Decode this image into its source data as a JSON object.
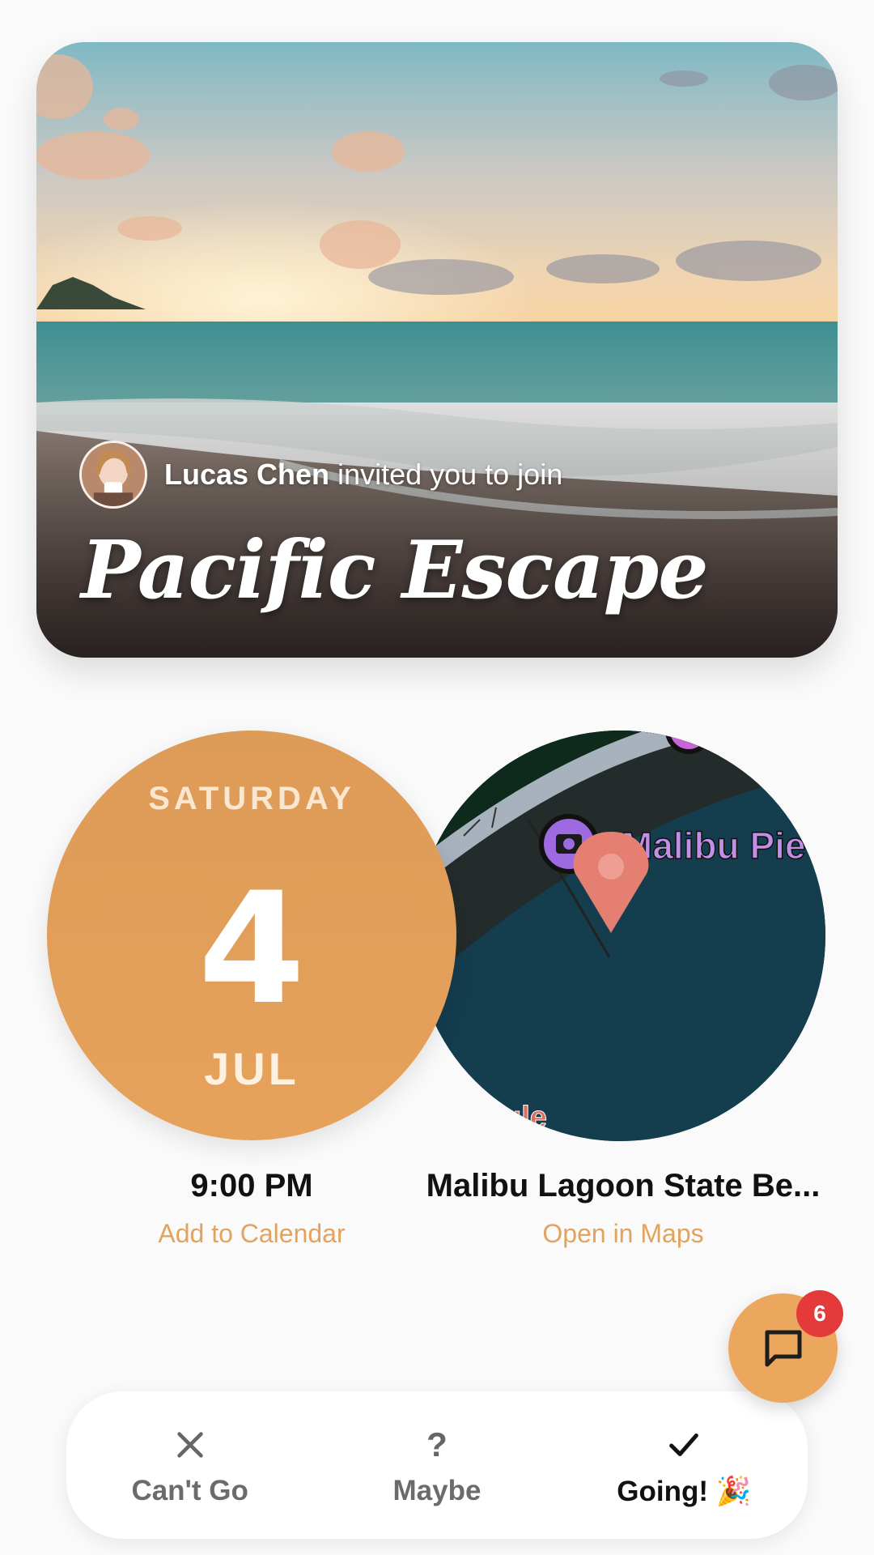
{
  "hero": {
    "host_name": "Lucas Chen",
    "invite_text": " invited you to join",
    "event_title": "Pacific Escape"
  },
  "date": {
    "day_of_week": "SATURDAY",
    "day": "4",
    "month": "JUL",
    "time": "9:00 PM",
    "calendar_link": "Add to Calendar"
  },
  "location": {
    "map_label": "Malibu Pie",
    "place_name": "Malibu Lagoon State Be...",
    "maps_link": "Open in Maps"
  },
  "chat": {
    "unread_count": "6",
    "icon": "chat-bubble-icon"
  },
  "rsvp": {
    "options": [
      {
        "label": "Can't Go",
        "icon": "close-icon"
      },
      {
        "label": "Maybe",
        "icon": "question-icon",
        "glyph": "?"
      },
      {
        "label": "Going! 🎉",
        "icon": "check-icon",
        "selected": true
      }
    ]
  },
  "colors": {
    "accent": "#e6a25b",
    "link": "#e3a35f",
    "badge": "#e53a3a",
    "map_water": "#143d4e",
    "pin": "#e57f72"
  }
}
